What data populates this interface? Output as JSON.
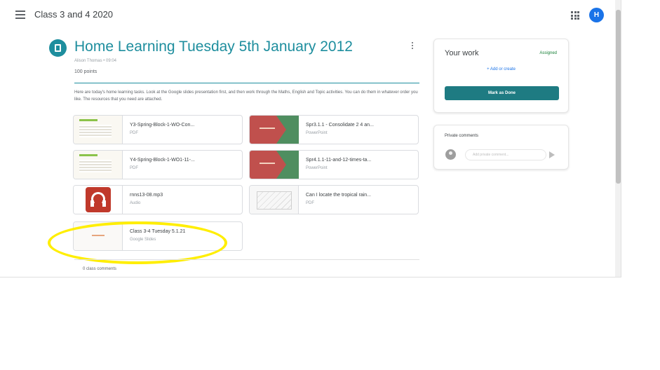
{
  "topbar": {
    "class_name": "Class 3 and 4 2020",
    "avatar_initial": "H"
  },
  "assignment": {
    "title": "Home Learning Tuesday 5th January 2012",
    "meta": "Alison Thomas • 09:04",
    "points": "100 points",
    "instructions": "Here are today's home learning tasks. Look at the Google slides presentation first, and then work through the Maths, English and Topic activities. You can do them in whatever order you like. The resources that you need are attached."
  },
  "attachments": [
    {
      "name": "Y3-Spring-Block-1-WO-Con...",
      "type": "PDF",
      "thumb": "doc"
    },
    {
      "name": "Spr3.1.1 - Consolidate 2 4 an...",
      "type": "PowerPoint",
      "thumb": "ppt"
    },
    {
      "name": "Y4-Spring-Block-1-WO1-11-...",
      "type": "PDF",
      "thumb": "doc"
    },
    {
      "name": "Spr4.1.1-11-and-12-times-ta...",
      "type": "PowerPoint",
      "thumb": "ppt"
    },
    {
      "name": "rnns13-08.mp3",
      "type": "Audio",
      "thumb": "audio"
    },
    {
      "name": "Can I locate the tropical rain...",
      "type": "PDF",
      "thumb": "map"
    },
    {
      "name": "Class 3-4 Tuesday 5.1.21",
      "type": "Google Slides",
      "thumb": "slide"
    }
  ],
  "class_comments": "0 class comments",
  "your_work": {
    "title": "Your work",
    "status": "Assigned",
    "add_label": "+ Add or create",
    "mark_done_label": "Mark as Done"
  },
  "private_comments": {
    "title": "Private comments",
    "placeholder": "Add private comment..."
  },
  "colors": {
    "accent": "#1e8e9e",
    "mark_done": "#1e7b82",
    "highlight": "#ffee00",
    "assigned_status": "#188038"
  }
}
